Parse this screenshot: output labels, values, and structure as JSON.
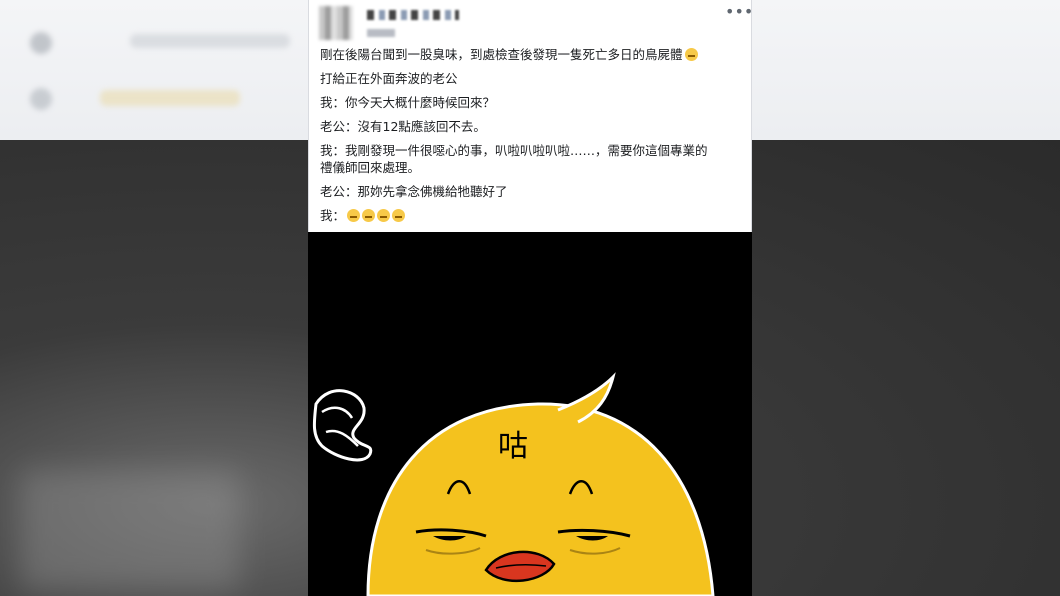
{
  "post": {
    "lines": [
      "剛在後陽台聞到一股臭味，到處檢查後發現一隻死亡多日的鳥屍體",
      "打給正在外面奔波的老公",
      "我：你今天大概什麼時候回來？",
      "老公：沒有12點應該回不去。",
      "我：我剛發現一件很噁心的事，叭啦叭啦叭啦……，需要你這個專業的\n禮儀師回來處理。",
      "老公：那妳先拿念佛機給牠聽好了",
      "我："
    ],
    "emoji_counts": [
      1,
      0,
      0,
      0,
      0,
      0,
      4
    ],
    "more_icon": "•••"
  },
  "image": {
    "forehead_text": "咕"
  },
  "colors": {
    "accent": "#f4c21e",
    "page_bg": "#ffffff",
    "text": "#1c1e21"
  }
}
